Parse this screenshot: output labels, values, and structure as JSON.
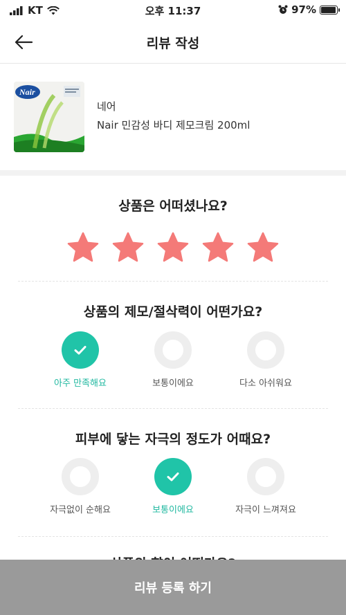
{
  "status": {
    "carrier": "KT",
    "time": "오후 11:37",
    "battery": "97%",
    "battery_level": 0.97
  },
  "header": {
    "title": "리뷰 작성"
  },
  "product": {
    "brand": "네어",
    "name": "Nair 민감성 바디 제모크림 200ml",
    "image_brand_text": "Nair"
  },
  "rating": {
    "question": "상품은 어떠셨나요?",
    "stars_selected": 5,
    "stars_total": 5,
    "star_color": "#f47a78"
  },
  "q2": {
    "question": "상품의 제모/절삭력이 어떤가요?",
    "options": [
      "아주 만족해요",
      "보통이에요",
      "다소 아쉬워요"
    ],
    "selected": 0
  },
  "q3": {
    "question": "피부에 닿는 자극의 정도가 어때요?",
    "options": [
      "자극없이 순해요",
      "보통이에요",
      "자극이 느껴져요"
    ],
    "selected": 1
  },
  "next_question_partial": "상품의 향이 어떤가요?",
  "submit": {
    "label": "리뷰 등록 하기"
  },
  "colors": {
    "accent": "#20c4a8",
    "submit_bg": "#9a9a9a",
    "star": "#f47a78"
  }
}
